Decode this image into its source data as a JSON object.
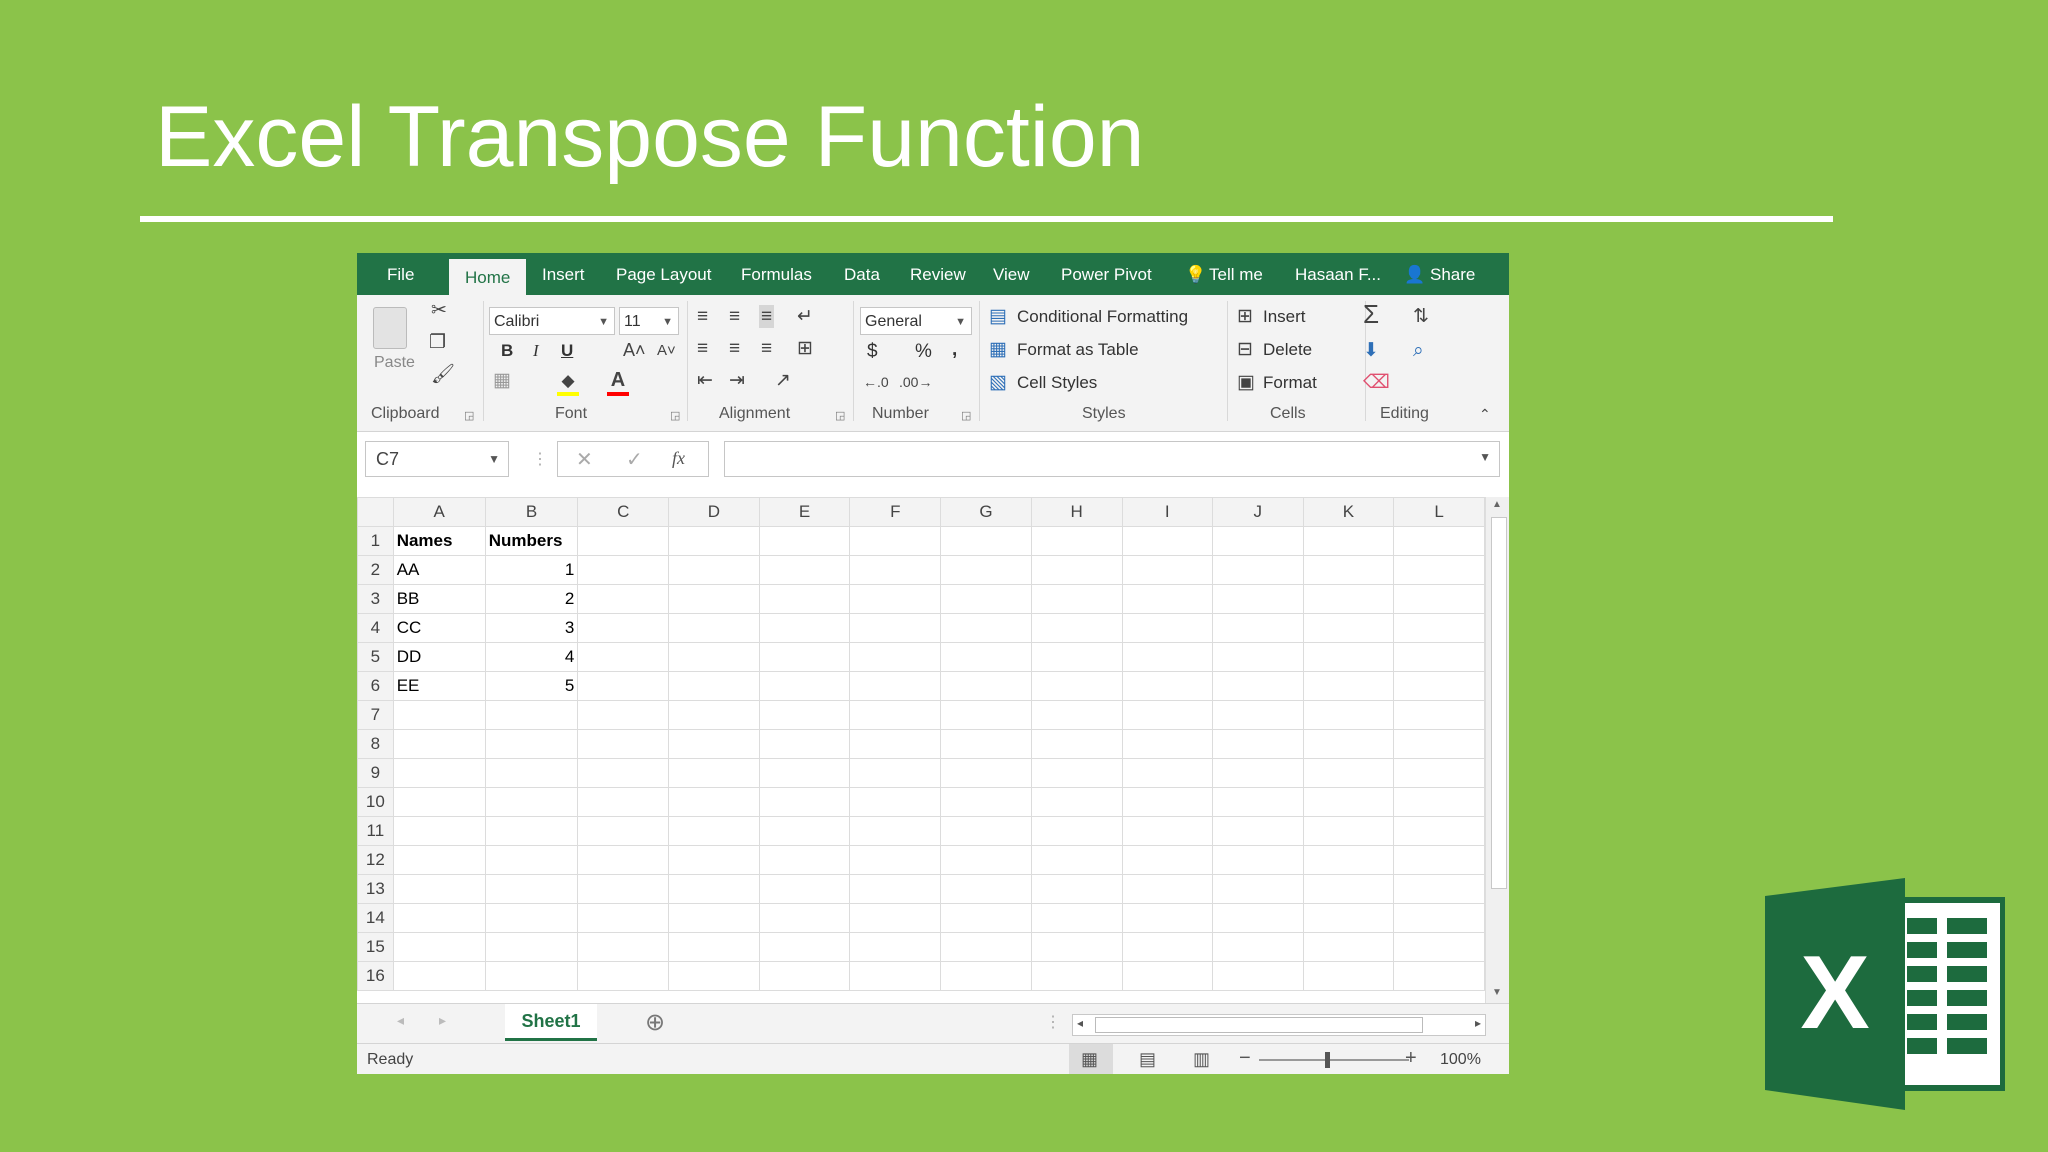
{
  "slide": {
    "title": "Excel Transpose Function"
  },
  "excel": {
    "tabs": [
      "File",
      "Home",
      "Insert",
      "Page Layout",
      "Formulas",
      "Data",
      "Review",
      "View",
      "Power Pivot",
      "Tell me",
      "Hasaan F...",
      "Share"
    ],
    "active_tab": "Home",
    "clipboard": {
      "paste_label": "Paste",
      "group_label": "Clipboard"
    },
    "font": {
      "name": "Calibri",
      "size": "11",
      "group_label": "Font",
      "bold": "B",
      "italic": "I",
      "underline": "U",
      "font_color": "#ff0000",
      "fill_color": "#ffff00"
    },
    "alignment": {
      "group_label": "Alignment"
    },
    "number": {
      "format": "General",
      "currency": "$",
      "percent": "%",
      "comma": ",",
      "group_label": "Number"
    },
    "styles": {
      "conditional_formatting": "Conditional Formatting",
      "format_as_table": "Format as Table",
      "cell_styles": "Cell Styles",
      "group_label": "Styles"
    },
    "cells": {
      "insert": "Insert",
      "delete": "Delete",
      "format": "Format",
      "group_label": "Cells"
    },
    "editing": {
      "group_label": "Editing"
    },
    "name_box": "C7",
    "formula": "",
    "fx_label": "fx",
    "columns": [
      "A",
      "B",
      "C",
      "D",
      "E",
      "F",
      "G",
      "H",
      "I",
      "J",
      "K",
      "L"
    ],
    "rows": [
      [
        "Names",
        "Numbers"
      ],
      [
        "AA",
        "1"
      ],
      [
        "BB",
        "2"
      ],
      [
        "CC",
        "3"
      ],
      [
        "DD",
        "4"
      ],
      [
        "EE",
        "5"
      ],
      [
        "",
        ""
      ],
      [
        "",
        ""
      ],
      [
        "",
        ""
      ],
      [
        "",
        ""
      ],
      [
        "",
        ""
      ],
      [
        "",
        ""
      ],
      [
        "",
        ""
      ],
      [
        "",
        ""
      ],
      [
        "",
        ""
      ],
      [
        "",
        ""
      ]
    ],
    "sheet_tab": "Sheet1",
    "status": "Ready",
    "zoom": "100%",
    "accent": "#217346"
  }
}
